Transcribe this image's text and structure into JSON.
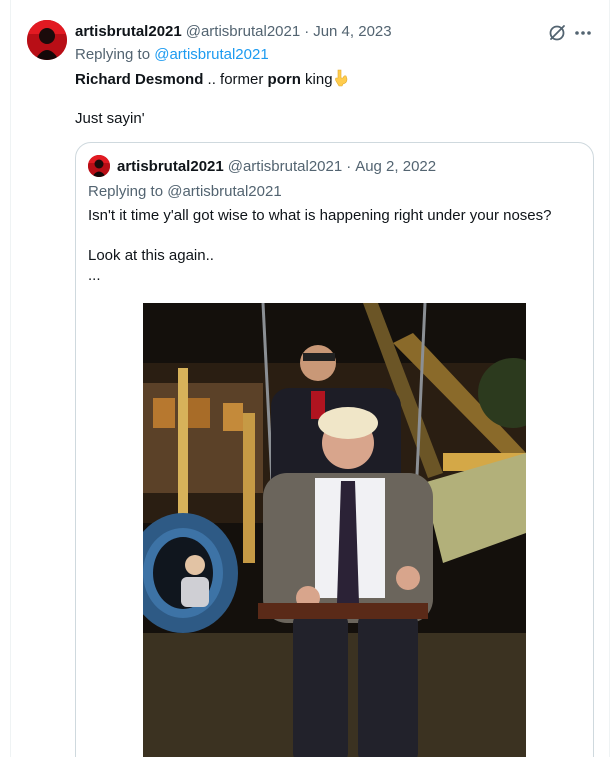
{
  "tweet": {
    "display_name": "artisbrutal2021",
    "handle": "@artisbrutal2021",
    "separator": "·",
    "date": "Jun 4, 2023",
    "replying_prefix": "Replying to",
    "replying_to": "@artisbrutal2021",
    "text": {
      "part1_bold": "Richard Desmond",
      "part2": " .. former ",
      "part3_bold": "porn",
      "part4": " king",
      "line2": "Just sayin'"
    },
    "emoji": "pointing-down-emoji"
  },
  "quoted_tweet": {
    "display_name": "artisbrutal2021",
    "handle": "@artisbrutal2021",
    "separator": "·",
    "date": "Aug 2, 2022",
    "replying_text": "Replying to @artisbrutal2021",
    "lines": [
      "Isn't it time y'all got wise to what is happening right under your noses?",
      "Look at this again..",
      "..."
    ]
  },
  "icons": {
    "avatar": "avatar",
    "grok": "grok-icon",
    "more": "more-icon"
  },
  "colors": {
    "text": "#0f1419",
    "secondary": "#536471",
    "link": "#1d9bf0",
    "border": "#cfd9de",
    "avatar_bg": "#c4111a"
  }
}
